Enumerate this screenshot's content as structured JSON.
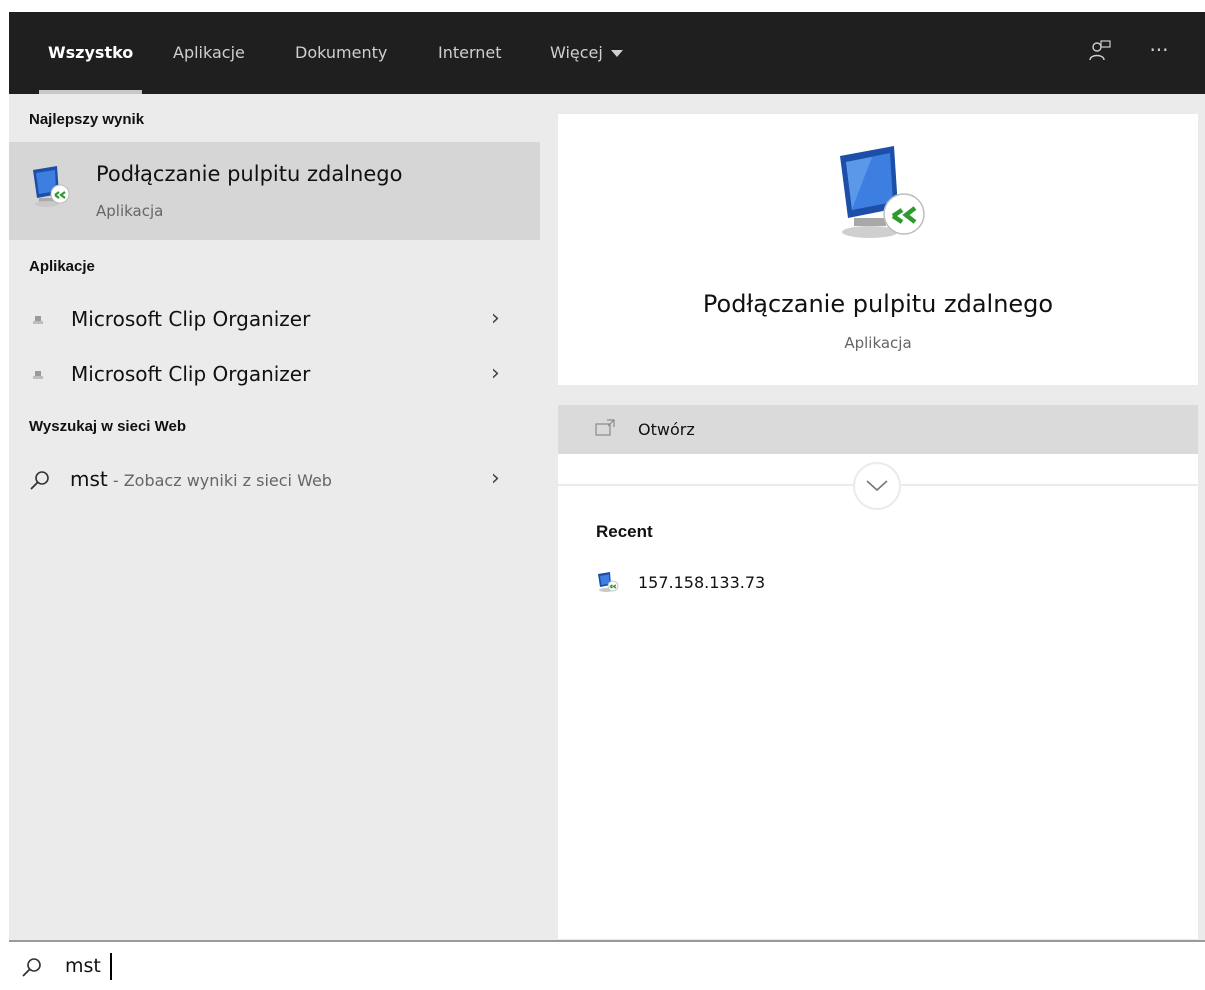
{
  "tabs": [
    {
      "label": "Wszystko",
      "active": true
    },
    {
      "label": "Aplikacje",
      "active": false
    },
    {
      "label": "Dokumenty",
      "active": false
    },
    {
      "label": "Internet",
      "active": false
    },
    {
      "label": "Więcej",
      "active": false
    }
  ],
  "top_icons": [
    "feedback-icon",
    "more-options-icon"
  ],
  "left": {
    "best_section": "Najlepszy wynik",
    "best": {
      "title": "Podłączanie pulpitu zdalnego",
      "subtitle": "Aplikacja",
      "icon": "remote-desktop-icon"
    },
    "apps_section": "Aplikacje",
    "apps": [
      {
        "label": "Microsoft Clip Organizer",
        "icon": "clip-organizer-icon"
      },
      {
        "label": "Microsoft Clip Organizer",
        "icon": "clip-organizer-icon"
      }
    ],
    "web_section": "Wyszukaj w sieci Web",
    "web": {
      "term": "mst",
      "rest": " - Zobacz wyniki z sieci Web"
    }
  },
  "right": {
    "title": "Podłączanie pulpitu zdalnego",
    "subtitle": "Aplikacja",
    "action_label": "Otwórz",
    "recent_title": "Recent",
    "recent_items": [
      {
        "label": "157.158.133.73",
        "icon": "remote-desktop-icon"
      }
    ]
  },
  "search": {
    "value": "mst"
  },
  "colors": {
    "topbar": "#1f1f1f",
    "pane": "#ebebeb",
    "selected": "#d6d6d6"
  }
}
